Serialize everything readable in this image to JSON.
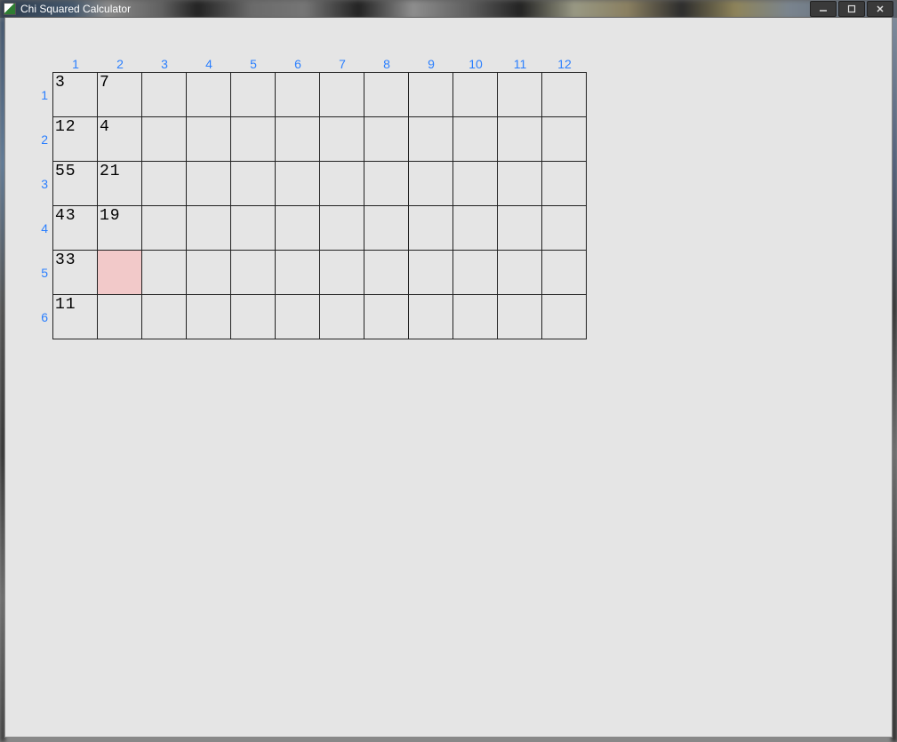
{
  "window": {
    "title": "Chi Squared Calculator"
  },
  "grid": {
    "columns": [
      "1",
      "2",
      "3",
      "4",
      "5",
      "6",
      "7",
      "8",
      "9",
      "10",
      "11",
      "12"
    ],
    "rows": [
      "1",
      "2",
      "3",
      "4",
      "5",
      "6"
    ],
    "cells": {
      "r1c1": "3",
      "r1c2": "7",
      "r2c1": "12",
      "r2c2": "4",
      "r3c1": "55",
      "r3c2": "21",
      "r4c1": "43",
      "r4c2": "19",
      "r5c1": "33",
      "r6c1": "11"
    },
    "selected": "r5c2"
  }
}
